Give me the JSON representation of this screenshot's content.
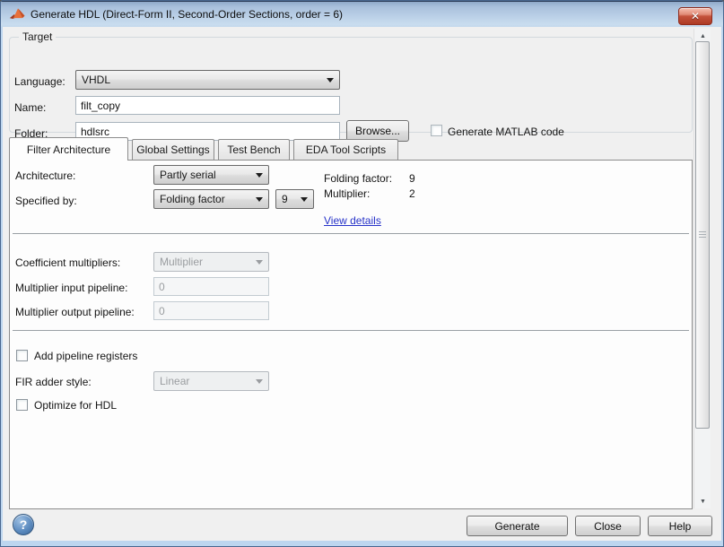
{
  "window": {
    "title": "Generate HDL (Direct-Form II, Second-Order Sections, order = 6)"
  },
  "icons": {
    "close": "✕",
    "help": "?",
    "scroll_up": "▲",
    "scroll_down": "▼"
  },
  "target": {
    "group_label": "Target",
    "language": {
      "label": "Language:",
      "value": "VHDL"
    },
    "name": {
      "label": "Name:",
      "value": "filt_copy"
    },
    "folder": {
      "label": "Folder:",
      "value": "hdlsrc"
    },
    "browse_label": "Browse...",
    "generate_matlab_label": "Generate MATLAB code",
    "generate_matlab_checked": false
  },
  "tabs": [
    {
      "label": "Filter Architecture",
      "active": true
    },
    {
      "label": "Global Settings",
      "active": false
    },
    {
      "label": "Test Bench",
      "active": false
    },
    {
      "label": "EDA Tool Scripts",
      "active": false
    }
  ],
  "panel": {
    "architecture": {
      "label": "Architecture:",
      "value": "Partly serial"
    },
    "specified_by": {
      "label": "Specified by:",
      "value": "Folding factor",
      "factor_value": "9"
    },
    "info": {
      "folding_factor_label": "Folding factor:",
      "folding_factor_value": "9",
      "multiplier_label": "Multiplier:",
      "multiplier_value": "2",
      "details_link": "View details"
    },
    "coefficient_multipliers": {
      "label": "Coefficient multipliers:",
      "value": "Multiplier",
      "disabled": true
    },
    "multiplier_input_pipeline": {
      "label": "Multiplier input pipeline:",
      "value": "0",
      "disabled": true
    },
    "multiplier_output_pipeline": {
      "label": "Multiplier output pipeline:",
      "value": "0",
      "disabled": true
    },
    "add_pipeline_registers": {
      "label": "Add pipeline registers",
      "checked": false
    },
    "fir_adder_style": {
      "label": "FIR adder style:",
      "value": "Linear",
      "disabled": true
    },
    "optimize_for_hdl": {
      "label": "Optimize for HDL",
      "checked": false
    }
  },
  "footer": {
    "generate_label": "Generate",
    "close_label": "Close",
    "help_label": "Help"
  },
  "colors": {
    "titlebar_top": "#a9c0dc",
    "titlebar_bottom": "#c9ddef",
    "dialog_bg": "#f0f0f0",
    "panel_bg": "#fdfdfd",
    "close_red": "#ad3a24",
    "link_blue": "#2733c9",
    "matlab_orange": "#e8703a",
    "matlab_dark_red": "#a13b22"
  }
}
